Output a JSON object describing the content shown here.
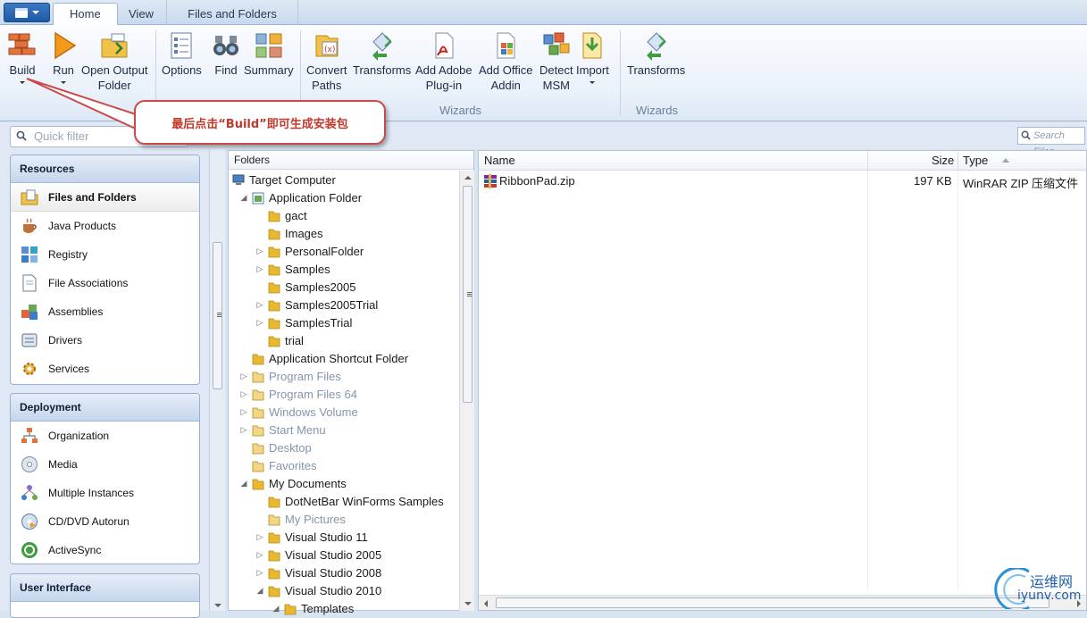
{
  "tabs": [
    {
      "label": "Home",
      "active": true
    },
    {
      "label": "View",
      "active": false
    },
    {
      "label": "Files and Folders",
      "active": false,
      "contextual": true
    }
  ],
  "ribbon": {
    "build": "Build",
    "run": "Run",
    "open_output_1": "Open Output",
    "open_output_2": "Folder",
    "options": "Options",
    "find": "Find",
    "summary": "Summary",
    "convert_1": "Convert",
    "convert_2": "Paths",
    "transforms": "Transforms",
    "add_adobe_1": "Add Adobe",
    "add_adobe_2": "Plug-in",
    "add_office_1": "Add Office",
    "add_office_2": "Addin",
    "detect_1": "Detect",
    "detect_2": "MSM",
    "import": "Import",
    "transforms2": "Transforms",
    "group_wizards": "Wizards",
    "group_wizards2": "Wizards"
  },
  "callout": {
    "text": "最后点击“Build”即可生成安装包"
  },
  "filter": {
    "quick_placeholder": "Quick filter",
    "search_placeholder": "Search Files"
  },
  "nav": {
    "resources": {
      "title": "Resources",
      "items": [
        "Files and Folders",
        "Java Products",
        "Registry",
        "File Associations",
        "Assemblies",
        "Drivers",
        "Services"
      ]
    },
    "deployment": {
      "title": "Deployment",
      "items": [
        "Organization",
        "Media",
        "Multiple Instances",
        "CD/DVD Autorun",
        "ActiveSync"
      ]
    },
    "ui": {
      "title": "User Interface"
    }
  },
  "folders": {
    "header": "Folders",
    "rows": [
      {
        "label": "Target Computer",
        "indent": 0,
        "toggle": "",
        "dim": false
      },
      {
        "label": "Application Folder",
        "indent": 1,
        "toggle": "open",
        "dim": false
      },
      {
        "label": "gact",
        "indent": 2,
        "toggle": "",
        "dim": false
      },
      {
        "label": "Images",
        "indent": 2,
        "toggle": "",
        "dim": false
      },
      {
        "label": "PersonalFolder",
        "indent": 2,
        "toggle": "closed",
        "dim": false
      },
      {
        "label": "Samples",
        "indent": 2,
        "toggle": "closed",
        "dim": false
      },
      {
        "label": "Samples2005",
        "indent": 2,
        "toggle": "",
        "dim": false
      },
      {
        "label": "Samples2005Trial",
        "indent": 2,
        "toggle": "closed",
        "dim": false
      },
      {
        "label": "SamplesTrial",
        "indent": 2,
        "toggle": "closed",
        "dim": false
      },
      {
        "label": "trial",
        "indent": 2,
        "toggle": "",
        "dim": false
      },
      {
        "label": "Application Shortcut Folder",
        "indent": 1,
        "toggle": "",
        "dim": false
      },
      {
        "label": "Program Files",
        "indent": 1,
        "toggle": "closed",
        "dim": true
      },
      {
        "label": "Program Files 64",
        "indent": 1,
        "toggle": "closed",
        "dim": true
      },
      {
        "label": "Windows Volume",
        "indent": 1,
        "toggle": "closed",
        "dim": true
      },
      {
        "label": "Start Menu",
        "indent": 1,
        "toggle": "closed",
        "dim": true
      },
      {
        "label": "Desktop",
        "indent": 1,
        "toggle": "",
        "dim": true
      },
      {
        "label": "Favorites",
        "indent": 1,
        "toggle": "",
        "dim": true
      },
      {
        "label": "My Documents",
        "indent": 1,
        "toggle": "open",
        "dim": false
      },
      {
        "label": "DotNetBar WinForms Samples",
        "indent": 2,
        "toggle": "",
        "dim": false
      },
      {
        "label": "My Pictures",
        "indent": 2,
        "toggle": "",
        "dim": true
      },
      {
        "label": "Visual Studio 11",
        "indent": 2,
        "toggle": "closed",
        "dim": false
      },
      {
        "label": "Visual Studio 2005",
        "indent": 2,
        "toggle": "closed",
        "dim": false
      },
      {
        "label": "Visual Studio 2008",
        "indent": 2,
        "toggle": "closed",
        "dim": false
      },
      {
        "label": "Visual Studio 2010",
        "indent": 2,
        "toggle": "open",
        "dim": false
      },
      {
        "label": "Templates",
        "indent": 3,
        "toggle": "open",
        "dim": false
      }
    ]
  },
  "files": {
    "columns": {
      "name": "Name",
      "size": "Size",
      "type": "Type"
    },
    "rows": [
      {
        "name": "RibbonPad.zip",
        "size": "197 KB",
        "type": "WinRAR ZIP 压缩文件"
      }
    ]
  },
  "watermark": {
    "line1": "运维网",
    "line2": "iyunv.com"
  },
  "colors": {
    "accent": "#1f5aa5",
    "callout_border": "#c94a4a",
    "folder": "#e8b830"
  }
}
